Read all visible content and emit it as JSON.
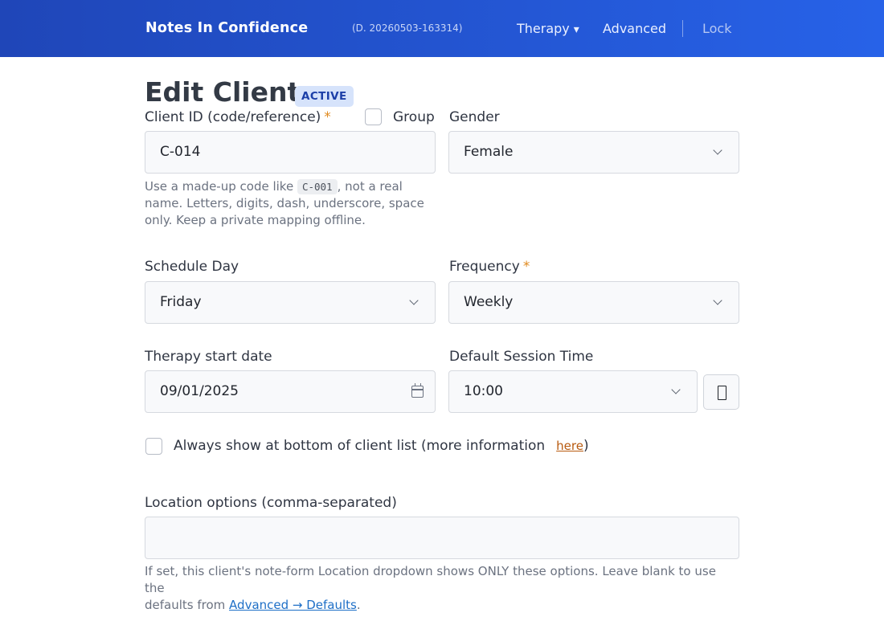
{
  "navbar": {
    "brand": "Notes In Confidence",
    "version": "(D. 20260503-163314)",
    "therapy": "Therapy",
    "therapy_caret": "▾",
    "advanced": "Advanced",
    "lock": "Lock"
  },
  "page": {
    "title": "Edit Client",
    "status_badge": "ACTIVE"
  },
  "form": {
    "client_id": {
      "label": "Client ID (code/reference)",
      "required_mark": "*",
      "value": "C-014",
      "help_before": "Use a made-up code like ",
      "help_code": "C-001",
      "help_line1_after": ", not a real",
      "help_line2": "name. Letters, digits, dash, underscore, space",
      "help_line3": "only. Keep a private mapping offline."
    },
    "group": {
      "label": "Group",
      "checked": false
    },
    "gender": {
      "label": "Gender",
      "value": "Female"
    },
    "schedule_day": {
      "label": "Schedule Day",
      "value": "Friday"
    },
    "frequency": {
      "label": "Frequency",
      "required_mark": "*",
      "value": "Weekly"
    },
    "start_date": {
      "label": "Therapy start date",
      "value": "09/01/2025"
    },
    "session_time": {
      "label": "Default Session Time",
      "value": "10:00"
    },
    "always_bottom": {
      "label": "Always show at bottom of client list (more information",
      "link": "here",
      "close": ")",
      "checked": false
    },
    "location": {
      "label": "Location options (comma-separated)",
      "value": "",
      "help_line1": "If set, this client's note-form Location dropdown shows ONLY these options. Leave blank to use the",
      "help_line2_before": "defaults from ",
      "help_link": "Advanced → Defaults",
      "help_line2_after": "."
    }
  }
}
